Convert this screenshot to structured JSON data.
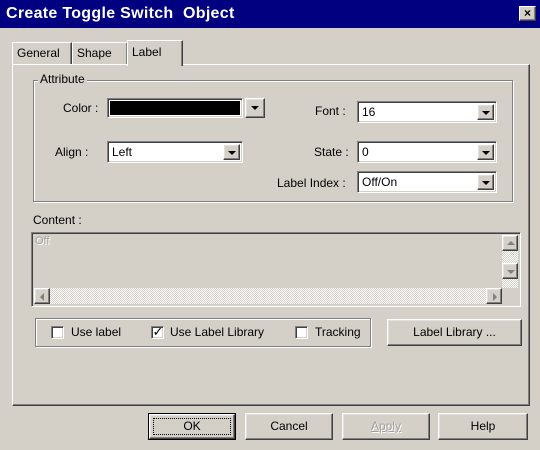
{
  "window": {
    "title": "Create Toggle Switch  Object",
    "close_label": "×"
  },
  "tabs": [
    {
      "label": "General",
      "active": false
    },
    {
      "label": "Shape",
      "active": false
    },
    {
      "label": "Label",
      "active": true
    }
  ],
  "attribute": {
    "group_title": "Attribute",
    "color_label": "Color :",
    "color_value": "#000000",
    "align_label": "Align :",
    "align_value": "Left",
    "font_label": "Font :",
    "font_value": "16",
    "state_label": "State :",
    "state_value": "0",
    "label_index_label": "Label Index :",
    "label_index_value": "Off/On"
  },
  "content": {
    "label": "Content :",
    "text": "Off"
  },
  "options": {
    "use_label": {
      "label": "Use label",
      "checked": false
    },
    "use_label_library": {
      "label": "Use Label Library",
      "checked": true
    },
    "tracking": {
      "label": "Tracking",
      "checked": false
    },
    "label_library_button": "Label Library ..."
  },
  "buttons": {
    "ok": "OK",
    "cancel": "Cancel",
    "apply": "Apply",
    "help": "Help"
  },
  "icons": {
    "close": "close-icon",
    "dropdown": "chevron-down-icon",
    "check": "checkmark-icon"
  }
}
